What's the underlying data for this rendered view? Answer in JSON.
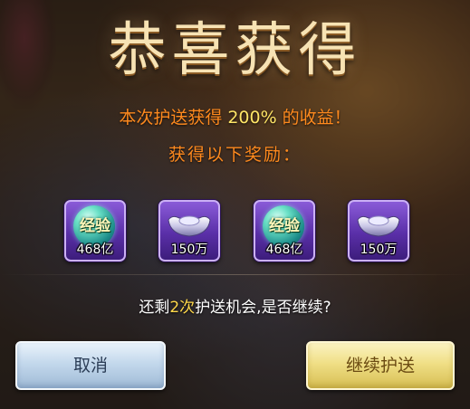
{
  "popup": {
    "title": "恭喜获得",
    "message": {
      "prefix": "本次护送获得",
      "percent": "200%",
      "suffix": "的收益！"
    },
    "rewards_heading": "获得以下奖励："
  },
  "rewards": [
    {
      "type": "experience",
      "icon": "exp-orb-icon",
      "label": "经验",
      "amount": "468亿"
    },
    {
      "type": "silver",
      "icon": "silver-ingot-icon",
      "label": "",
      "amount": "150万"
    },
    {
      "type": "experience",
      "icon": "exp-orb-icon",
      "label": "经验",
      "amount": "468亿"
    },
    {
      "type": "silver",
      "icon": "silver-ingot-icon",
      "label": "",
      "amount": "150万"
    }
  ],
  "prompt": {
    "prefix": "还剩",
    "count": "2次",
    "suffix": "护送机会,是否继续?"
  },
  "buttons": {
    "cancel": "取消",
    "continue": "继续护送"
  },
  "colors": {
    "highlight_orange": "#ff8a1e",
    "highlight_yellow": "#ffe566",
    "reward_frame": "#5a2fa8",
    "cancel_button": "#c3d8ec",
    "continue_button": "#f0df86"
  }
}
